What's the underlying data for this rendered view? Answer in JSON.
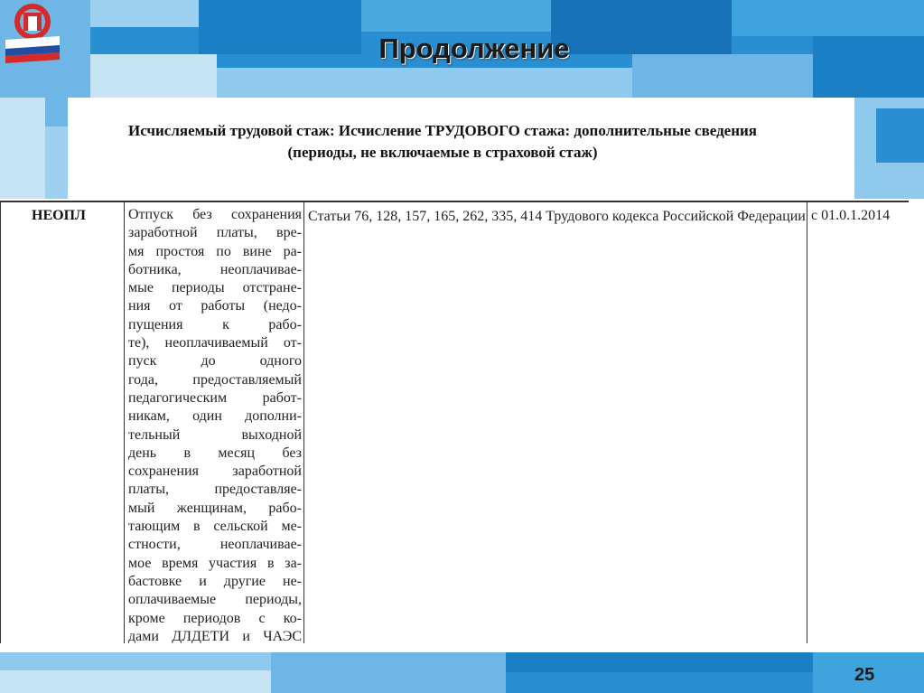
{
  "slide": {
    "title": "Продолжение",
    "subtitle_line1": "Исчисляемый трудовой стаж: Исчисление ТРУДОВОГО стажа: дополнительные сведения",
    "subtitle_line2": "(периоды, не включаемые  в страховой стаж)",
    "page_number": "25"
  },
  "logo": {
    "icon": "pfr-logo-icon",
    "colors": [
      "#d42a2a",
      "#ffffff",
      "#1e4fa3"
    ]
  },
  "table": {
    "row": {
      "code": "НЕОПЛ",
      "description_lines": [
        "Отпуск без сохранения",
        "заработной платы, вре-",
        "мя простоя по вине ра-",
        "ботника, неоплачивае-",
        "мые периоды отстране-",
        "ния от работы (недо-",
        "пущения к рабо-",
        "те), неоплачиваемый от-",
        "пуск до одного",
        "года, предоставляемый",
        "педагогическим работ-",
        "никам, один дополни-",
        "тельный выходной",
        "день в месяц без",
        "сохранения заработной",
        "платы, предоставляе-",
        "мый женщинам, рабо-",
        "тающим в сельской ме-",
        "стности, неоплачивае-",
        "мое время участия в за-",
        "бастовке и другие не-",
        "оплачиваемые периоды,",
        "кроме периодов с ко-",
        "дами ДЛДЕТИ и ЧАЭС"
      ],
      "law": "Статьи 76, 128, 157, 165, 262, 335, 414 Трудового кодекса Российской Федерации",
      "date": "с 01.0.1.2014"
    }
  },
  "colors": {
    "blue_dark": "#1a7fc4",
    "blue_mid": "#3aa0dc",
    "blue_light": "#8fcaee",
    "blue_pale": "#c6e4f6"
  }
}
